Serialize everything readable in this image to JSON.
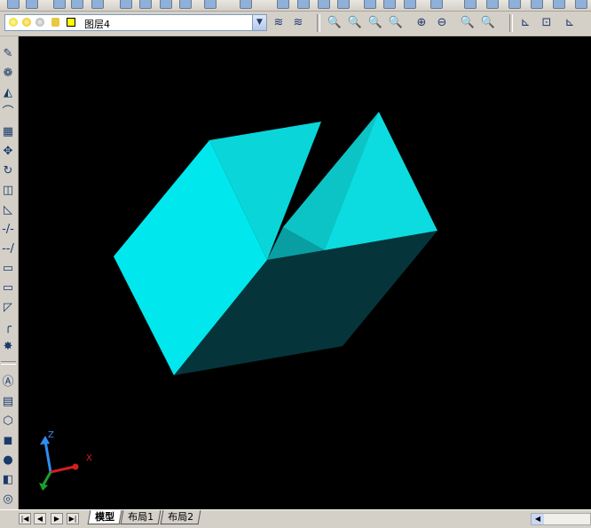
{
  "layer_toolbar": {
    "current_layer": "图层4"
  },
  "layout_tabs": [
    {
      "label": "模型",
      "active": true
    },
    {
      "label": "布局1",
      "active": false
    },
    {
      "label": "布局2",
      "active": false
    }
  ],
  "ucs_icon": {
    "z_label": "Z",
    "x_label": "X"
  },
  "colors": {
    "viewport_background": "#000000",
    "solid_face_light": "#00e8ee",
    "solid_face_mid": "#0cd8dc",
    "solid_face_dark": "#05353a"
  }
}
